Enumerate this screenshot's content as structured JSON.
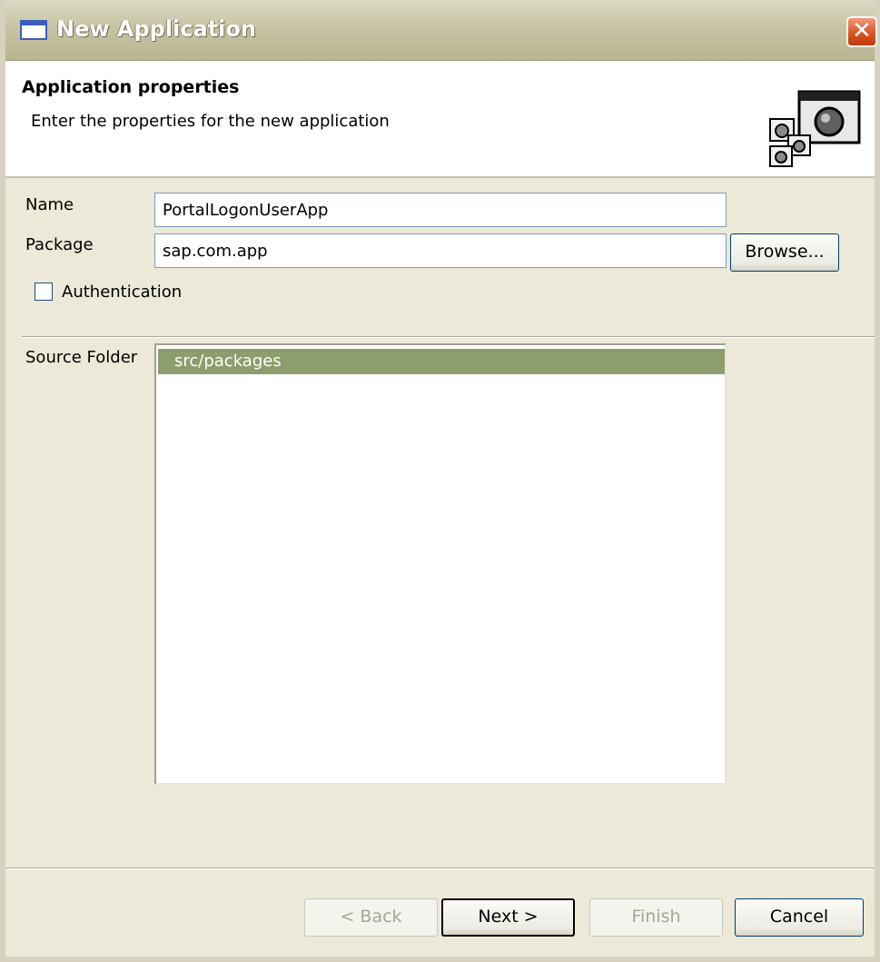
{
  "window": {
    "title": "New Application",
    "close_glyph": "✕"
  },
  "header": {
    "title": "Application properties",
    "description": "Enter the properties for the new application"
  },
  "form": {
    "name_label": "Name",
    "name_value": "PortalLogonUserApp",
    "package_label": "Package",
    "package_value": "sap.com.app",
    "browse_label": "Browse...",
    "authentication_label": "Authentication",
    "authentication_checked": false
  },
  "source_folder": {
    "label": "Source Folder",
    "items": [
      "src/packages"
    ],
    "selected": "src/packages"
  },
  "footer": {
    "back_label": "< Back",
    "next_label": "Next >",
    "finish_label": "Finish",
    "cancel_label": "Cancel"
  },
  "icons": {
    "wizard_banner": "application-wizard-icon",
    "title": "window-icon",
    "close": "close-icon"
  }
}
